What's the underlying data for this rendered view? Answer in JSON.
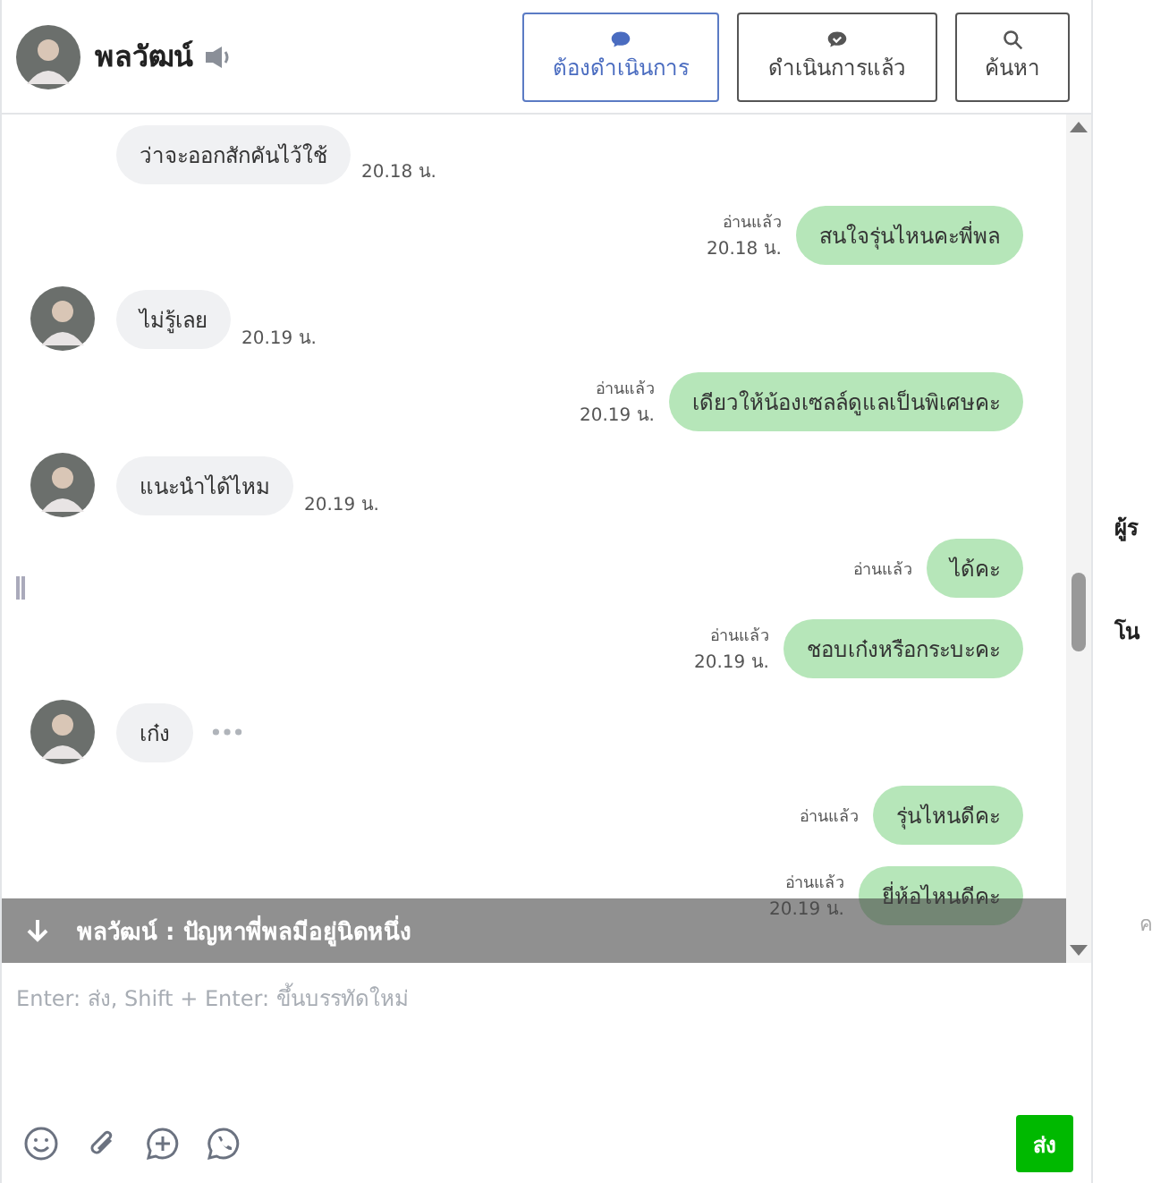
{
  "header": {
    "name": "พลวัฒน์",
    "buttons": [
      {
        "label": "ต้องดำเนินการ",
        "selected": true
      },
      {
        "label": "ดำเนินการแล้ว",
        "selected": false
      },
      {
        "label": "ค้นหา",
        "selected": false
      }
    ]
  },
  "messages": [
    {
      "kind": "in",
      "text": "ว่าจะออกสักคันไว้ใช้",
      "time": "20.18 น.",
      "avatar": false,
      "typing": false
    },
    {
      "kind": "out",
      "text": "สนใจรุ่นไหนคะพี่พล",
      "read": "อ่านแล้ว",
      "time": "20.18 น."
    },
    {
      "kind": "in",
      "text": "ไม่รู้เลย",
      "time": "20.19 น.",
      "avatar": true,
      "typing": false
    },
    {
      "kind": "out",
      "text": "เดียวให้น้องเซลล์ดูแลเป็นพิเศษคะ",
      "read": "อ่านแล้ว",
      "time": "20.19 น."
    },
    {
      "kind": "in",
      "text": "แนะนำได้ไหม",
      "time": "20.19 น.",
      "avatar": true,
      "typing": false
    },
    {
      "kind": "out",
      "text": "ได้คะ",
      "read": "อ่านแล้ว"
    },
    {
      "kind": "out",
      "text": "ชอบเก๋งหรือกระบะคะ",
      "read": "อ่านแล้ว",
      "time": "20.19 น."
    },
    {
      "kind": "in",
      "text": "เก๋ง",
      "avatar": true,
      "typing": true
    },
    {
      "kind": "out",
      "text": "รุ่นไหนดีคะ",
      "read": "อ่านแล้ว"
    },
    {
      "kind": "out",
      "text": "ยี่ห้อไหนดีคะ",
      "read": "อ่านแล้ว",
      "time": "20.19 น."
    }
  ],
  "banner": {
    "text": "พลวัฒน์ : ปัญหาพี่พลมีอยู่นิดหนึ่ง"
  },
  "composer": {
    "placeholder": "Enter: ส่ง, Shift + Enter: ขึ้นบรรทัดใหม่",
    "send": "ส่ง"
  },
  "side_panel": {
    "texts": [
      "ผู้ร",
      "โน",
      "ค"
    ]
  }
}
